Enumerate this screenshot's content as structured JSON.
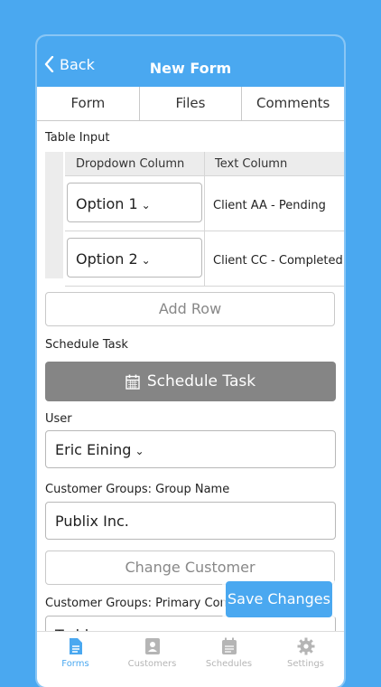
{
  "nav": {
    "back_label": "Back",
    "title": "New Form"
  },
  "tabs": [
    {
      "label": "Form"
    },
    {
      "label": "Files"
    },
    {
      "label": "Comments"
    }
  ],
  "table_input": {
    "label": "Table Input",
    "columns": [
      "Dropdown Column",
      "Text Column"
    ],
    "rows": [
      {
        "dropdown": "Option 1",
        "text": "Client AA - Pending"
      },
      {
        "dropdown": "Option 2",
        "text": "Client CC - Completed"
      }
    ],
    "add_row_label": "Add Row"
  },
  "schedule": {
    "label": "Schedule Task",
    "button_label": "Schedule Task"
  },
  "user": {
    "label": "User",
    "value": "Eric Eining"
  },
  "group_name": {
    "label": "Customer Groups: Group Name",
    "value": "Publix Inc."
  },
  "change_customer_label": "Change Customer",
  "primary_contact": {
    "label": "Customer Groups: Primary Conta",
    "value": "Todd"
  },
  "save_label": "Save Changes",
  "tabbar": [
    {
      "label": "Forms",
      "icon": "document-icon",
      "active": true
    },
    {
      "label": "Customers",
      "icon": "contact-card-icon"
    },
    {
      "label": "Schedules",
      "icon": "calendar-icon"
    },
    {
      "label": "Settings",
      "icon": "gear-icon"
    }
  ],
  "colors": {
    "accent": "#4aa8f0",
    "button_grey": "#858585"
  }
}
